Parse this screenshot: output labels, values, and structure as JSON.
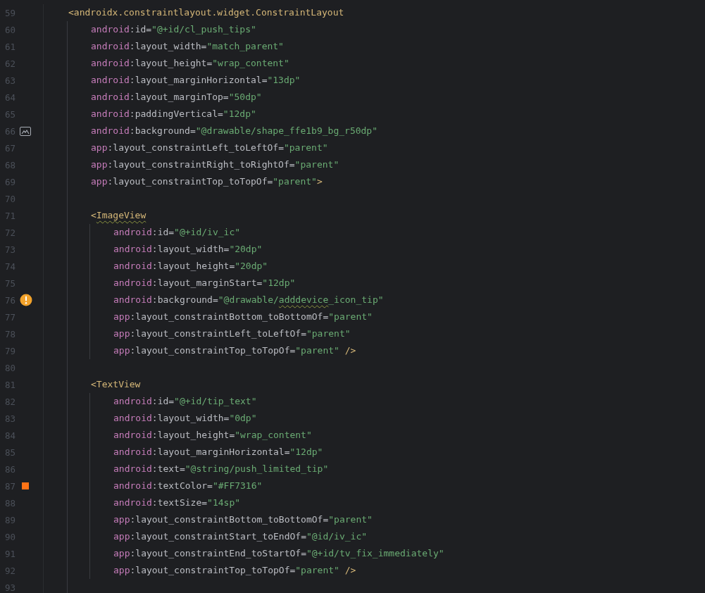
{
  "editor": {
    "lines": [
      {
        "number": "59",
        "tokens": [
          {
            "kind": "tag",
            "text": "<androidx.constraintlayout.widget.ConstraintLayout"
          }
        ],
        "children": [
          {
            "number": "60",
            "tokens": [
              {
                "kind": "ns",
                "text": "android"
              },
              {
                "kind": "punct",
                "text": ":"
              },
              {
                "kind": "attr",
                "text": "id"
              },
              {
                "kind": "punct",
                "text": "="
              },
              {
                "kind": "str",
                "text": "\"@+id/cl_push_tips\""
              }
            ]
          },
          {
            "number": "61",
            "tokens": [
              {
                "kind": "ns",
                "text": "android"
              },
              {
                "kind": "punct",
                "text": ":"
              },
              {
                "kind": "attr",
                "text": "layout_width"
              },
              {
                "kind": "punct",
                "text": "="
              },
              {
                "kind": "str",
                "text": "\"match_parent\""
              }
            ]
          },
          {
            "number": "62",
            "tokens": [
              {
                "kind": "ns",
                "text": "android"
              },
              {
                "kind": "punct",
                "text": ":"
              },
              {
                "kind": "attr",
                "text": "layout_height"
              },
              {
                "kind": "punct",
                "text": "="
              },
              {
                "kind": "str",
                "text": "\"wrap_content\""
              }
            ]
          },
          {
            "number": "63",
            "tokens": [
              {
                "kind": "ns",
                "text": "android"
              },
              {
                "kind": "punct",
                "text": ":"
              },
              {
                "kind": "attr",
                "text": "layout_marginHorizontal"
              },
              {
                "kind": "punct",
                "text": "="
              },
              {
                "kind": "str",
                "text": "\"13dp\""
              }
            ]
          },
          {
            "number": "64",
            "tokens": [
              {
                "kind": "ns",
                "text": "android"
              },
              {
                "kind": "punct",
                "text": ":"
              },
              {
                "kind": "attr",
                "text": "layout_marginTop"
              },
              {
                "kind": "punct",
                "text": "="
              },
              {
                "kind": "str",
                "text": "\"50dp\""
              }
            ]
          },
          {
            "number": "65",
            "tokens": [
              {
                "kind": "ns",
                "text": "android"
              },
              {
                "kind": "punct",
                "text": ":"
              },
              {
                "kind": "attr",
                "text": "paddingVertical"
              },
              {
                "kind": "punct",
                "text": "="
              },
              {
                "kind": "str",
                "text": "\"12dp\""
              }
            ]
          },
          {
            "number": "66",
            "marker": {
              "kind": "image"
            },
            "tokens": [
              {
                "kind": "ns",
                "text": "android"
              },
              {
                "kind": "punct",
                "text": ":"
              },
              {
                "kind": "attr",
                "text": "background"
              },
              {
                "kind": "punct",
                "text": "="
              },
              {
                "kind": "str",
                "text": "\"@drawable/shape_ffe1b9_bg_r50dp\""
              }
            ]
          },
          {
            "number": "67",
            "tokens": [
              {
                "kind": "ns",
                "text": "app"
              },
              {
                "kind": "punct",
                "text": ":"
              },
              {
                "kind": "attr",
                "text": "layout_constraintLeft_toLeftOf"
              },
              {
                "kind": "punct",
                "text": "="
              },
              {
                "kind": "str",
                "text": "\"parent\""
              }
            ]
          },
          {
            "number": "68",
            "tokens": [
              {
                "kind": "ns",
                "text": "app"
              },
              {
                "kind": "punct",
                "text": ":"
              },
              {
                "kind": "attr",
                "text": "layout_constraintRight_toRightOf"
              },
              {
                "kind": "punct",
                "text": "="
              },
              {
                "kind": "str",
                "text": "\"parent\""
              }
            ]
          },
          {
            "number": "69",
            "tokens": [
              {
                "kind": "ns",
                "text": "app"
              },
              {
                "kind": "punct",
                "text": ":"
              },
              {
                "kind": "attr",
                "text": "layout_constraintTop_toTopOf"
              },
              {
                "kind": "punct",
                "text": "="
              },
              {
                "kind": "str",
                "text": "\"parent\""
              },
              {
                "kind": "tag",
                "text": ">"
              }
            ]
          },
          {
            "number": "70"
          },
          {
            "number": "71",
            "tokens": [
              {
                "kind": "tag",
                "text": "<"
              },
              {
                "kind": "tag",
                "text": "ImageView",
                "typo": true
              }
            ],
            "children": [
              {
                "number": "72",
                "tokens": [
                  {
                    "kind": "ns",
                    "text": "android"
                  },
                  {
                    "kind": "punct",
                    "text": ":"
                  },
                  {
                    "kind": "attr",
                    "text": "id"
                  },
                  {
                    "kind": "punct",
                    "text": "="
                  },
                  {
                    "kind": "str",
                    "text": "\"@+id/iv_ic\""
                  }
                ]
              },
              {
                "number": "73",
                "tokens": [
                  {
                    "kind": "ns",
                    "text": "android"
                  },
                  {
                    "kind": "punct",
                    "text": ":"
                  },
                  {
                    "kind": "attr",
                    "text": "layout_width"
                  },
                  {
                    "kind": "punct",
                    "text": "="
                  },
                  {
                    "kind": "str",
                    "text": "\"20dp\""
                  }
                ]
              },
              {
                "number": "74",
                "tokens": [
                  {
                    "kind": "ns",
                    "text": "android"
                  },
                  {
                    "kind": "punct",
                    "text": ":"
                  },
                  {
                    "kind": "attr",
                    "text": "layout_height"
                  },
                  {
                    "kind": "punct",
                    "text": "="
                  },
                  {
                    "kind": "str",
                    "text": "\"20dp\""
                  }
                ]
              },
              {
                "number": "75",
                "tokens": [
                  {
                    "kind": "ns",
                    "text": "android"
                  },
                  {
                    "kind": "punct",
                    "text": ":"
                  },
                  {
                    "kind": "attr",
                    "text": "layout_marginStart"
                  },
                  {
                    "kind": "punct",
                    "text": "="
                  },
                  {
                    "kind": "str",
                    "text": "\"12dp\""
                  }
                ]
              },
              {
                "number": "76",
                "marker": {
                  "kind": "warning"
                },
                "tokens": [
                  {
                    "kind": "ns",
                    "text": "android"
                  },
                  {
                    "kind": "punct",
                    "text": ":"
                  },
                  {
                    "kind": "attr",
                    "text": "background"
                  },
                  {
                    "kind": "punct",
                    "text": "="
                  },
                  {
                    "kind": "str",
                    "text": "\"@drawable/"
                  },
                  {
                    "kind": "str",
                    "text": "adddevice",
                    "typo": true
                  },
                  {
                    "kind": "str",
                    "text": "_icon_tip\""
                  }
                ]
              },
              {
                "number": "77",
                "tokens": [
                  {
                    "kind": "ns",
                    "text": "app"
                  },
                  {
                    "kind": "punct",
                    "text": ":"
                  },
                  {
                    "kind": "attr",
                    "text": "layout_constraintBottom_toBottomOf"
                  },
                  {
                    "kind": "punct",
                    "text": "="
                  },
                  {
                    "kind": "str",
                    "text": "\"parent\""
                  }
                ]
              },
              {
                "number": "78",
                "tokens": [
                  {
                    "kind": "ns",
                    "text": "app"
                  },
                  {
                    "kind": "punct",
                    "text": ":"
                  },
                  {
                    "kind": "attr",
                    "text": "layout_constraintLeft_toLeftOf"
                  },
                  {
                    "kind": "punct",
                    "text": "="
                  },
                  {
                    "kind": "str",
                    "text": "\"parent\""
                  }
                ]
              },
              {
                "number": "79",
                "tokens": [
                  {
                    "kind": "ns",
                    "text": "app"
                  },
                  {
                    "kind": "punct",
                    "text": ":"
                  },
                  {
                    "kind": "attr",
                    "text": "layout_constraintTop_toTopOf"
                  },
                  {
                    "kind": "punct",
                    "text": "="
                  },
                  {
                    "kind": "str",
                    "text": "\"parent\""
                  },
                  {
                    "kind": "tag",
                    "text": " />"
                  }
                ]
              }
            ]
          },
          {
            "number": "80"
          },
          {
            "number": "81",
            "tokens": [
              {
                "kind": "tag",
                "text": "<TextView"
              }
            ],
            "children": [
              {
                "number": "82",
                "tokens": [
                  {
                    "kind": "ns",
                    "text": "android"
                  },
                  {
                    "kind": "punct",
                    "text": ":"
                  },
                  {
                    "kind": "attr",
                    "text": "id"
                  },
                  {
                    "kind": "punct",
                    "text": "="
                  },
                  {
                    "kind": "str",
                    "text": "\"@+id/tip_text\""
                  }
                ]
              },
              {
                "number": "83",
                "tokens": [
                  {
                    "kind": "ns",
                    "text": "android"
                  },
                  {
                    "kind": "punct",
                    "text": ":"
                  },
                  {
                    "kind": "attr",
                    "text": "layout_width"
                  },
                  {
                    "kind": "punct",
                    "text": "="
                  },
                  {
                    "kind": "str",
                    "text": "\"0dp\""
                  }
                ]
              },
              {
                "number": "84",
                "tokens": [
                  {
                    "kind": "ns",
                    "text": "android"
                  },
                  {
                    "kind": "punct",
                    "text": ":"
                  },
                  {
                    "kind": "attr",
                    "text": "layout_height"
                  },
                  {
                    "kind": "punct",
                    "text": "="
                  },
                  {
                    "kind": "str",
                    "text": "\"wrap_content\""
                  }
                ]
              },
              {
                "number": "85",
                "tokens": [
                  {
                    "kind": "ns",
                    "text": "android"
                  },
                  {
                    "kind": "punct",
                    "text": ":"
                  },
                  {
                    "kind": "attr",
                    "text": "layout_marginHorizontal"
                  },
                  {
                    "kind": "punct",
                    "text": "="
                  },
                  {
                    "kind": "str",
                    "text": "\"12dp\""
                  }
                ]
              },
              {
                "number": "86",
                "tokens": [
                  {
                    "kind": "ns",
                    "text": "android"
                  },
                  {
                    "kind": "punct",
                    "text": ":"
                  },
                  {
                    "kind": "attr",
                    "text": "text"
                  },
                  {
                    "kind": "punct",
                    "text": "="
                  },
                  {
                    "kind": "str",
                    "text": "\"@string/push_limited_tip\""
                  }
                ]
              },
              {
                "number": "87",
                "marker": {
                  "kind": "color",
                  "color": "#ff7316"
                },
                "tokens": [
                  {
                    "kind": "ns",
                    "text": "android"
                  },
                  {
                    "kind": "punct",
                    "text": ":"
                  },
                  {
                    "kind": "attr",
                    "text": "textColor"
                  },
                  {
                    "kind": "punct",
                    "text": "="
                  },
                  {
                    "kind": "str",
                    "text": "\"#FF7316\""
                  }
                ]
              },
              {
                "number": "88",
                "tokens": [
                  {
                    "kind": "ns",
                    "text": "android"
                  },
                  {
                    "kind": "punct",
                    "text": ":"
                  },
                  {
                    "kind": "attr",
                    "text": "textSize"
                  },
                  {
                    "kind": "punct",
                    "text": "="
                  },
                  {
                    "kind": "str",
                    "text": "\"14sp\""
                  }
                ]
              },
              {
                "number": "89",
                "tokens": [
                  {
                    "kind": "ns",
                    "text": "app"
                  },
                  {
                    "kind": "punct",
                    "text": ":"
                  },
                  {
                    "kind": "attr",
                    "text": "layout_constraintBottom_toBottomOf"
                  },
                  {
                    "kind": "punct",
                    "text": "="
                  },
                  {
                    "kind": "str",
                    "text": "\"parent\""
                  }
                ]
              },
              {
                "number": "90",
                "tokens": [
                  {
                    "kind": "ns",
                    "text": "app"
                  },
                  {
                    "kind": "punct",
                    "text": ":"
                  },
                  {
                    "kind": "attr",
                    "text": "layout_constraintStart_toEndOf"
                  },
                  {
                    "kind": "punct",
                    "text": "="
                  },
                  {
                    "kind": "str",
                    "text": "\"@id/iv_ic\""
                  }
                ]
              },
              {
                "number": "91",
                "tokens": [
                  {
                    "kind": "ns",
                    "text": "app"
                  },
                  {
                    "kind": "punct",
                    "text": ":"
                  },
                  {
                    "kind": "attr",
                    "text": "layout_constraintEnd_toStartOf"
                  },
                  {
                    "kind": "punct",
                    "text": "="
                  },
                  {
                    "kind": "str",
                    "text": "\"@+id/tv_fix_immediately\""
                  }
                ]
              },
              {
                "number": "92",
                "tokens": [
                  {
                    "kind": "ns",
                    "text": "app"
                  },
                  {
                    "kind": "punct",
                    "text": ":"
                  },
                  {
                    "kind": "attr",
                    "text": "layout_constraintTop_toTopOf"
                  },
                  {
                    "kind": "punct",
                    "text": "="
                  },
                  {
                    "kind": "str",
                    "text": "\"parent\""
                  },
                  {
                    "kind": "tag",
                    "text": " />"
                  }
                ]
              }
            ]
          },
          {
            "number": "93"
          }
        ]
      }
    ]
  }
}
